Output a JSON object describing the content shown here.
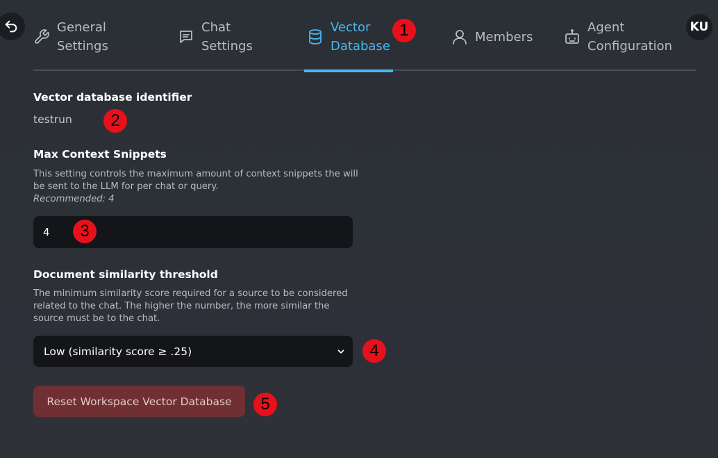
{
  "header": {
    "back_icon": "undo-arrow-icon",
    "avatar_initials": "KU",
    "tabs": [
      {
        "label": "General\nSettings",
        "icon": "wrench-icon",
        "active": false
      },
      {
        "label": "Chat\nSettings",
        "icon": "chat-bubble-icon",
        "active": false
      },
      {
        "label": "Vector\nDatabase",
        "icon": "database-icon",
        "active": true
      },
      {
        "label": "Members",
        "icon": "user-icon",
        "active": false
      },
      {
        "label": "Agent\nConfiguration",
        "icon": "robot-icon",
        "active": false
      }
    ],
    "accent_color": "#46b8f0"
  },
  "vector_db": {
    "identifier_title": "Vector database identifier",
    "identifier_value": "testrun"
  },
  "snippets": {
    "title": "Max Context Snippets",
    "description": "This setting controls the maximum amount of context snippets the will be sent to the LLM for per chat or query.",
    "recommendation": "Recommended: 4",
    "value": "4"
  },
  "similarity": {
    "title": "Document similarity threshold",
    "description": "The minimum similarity score required for a source to be considered related to the chat. The higher the number, the more similar the source must be to the chat.",
    "selected_option": "Low (similarity score ≥ .25)"
  },
  "reset_button_label": "Reset Workspace Vector Database",
  "markers": [
    "1",
    "2",
    "3",
    "4",
    "5"
  ],
  "marker_color": "#e8111b"
}
